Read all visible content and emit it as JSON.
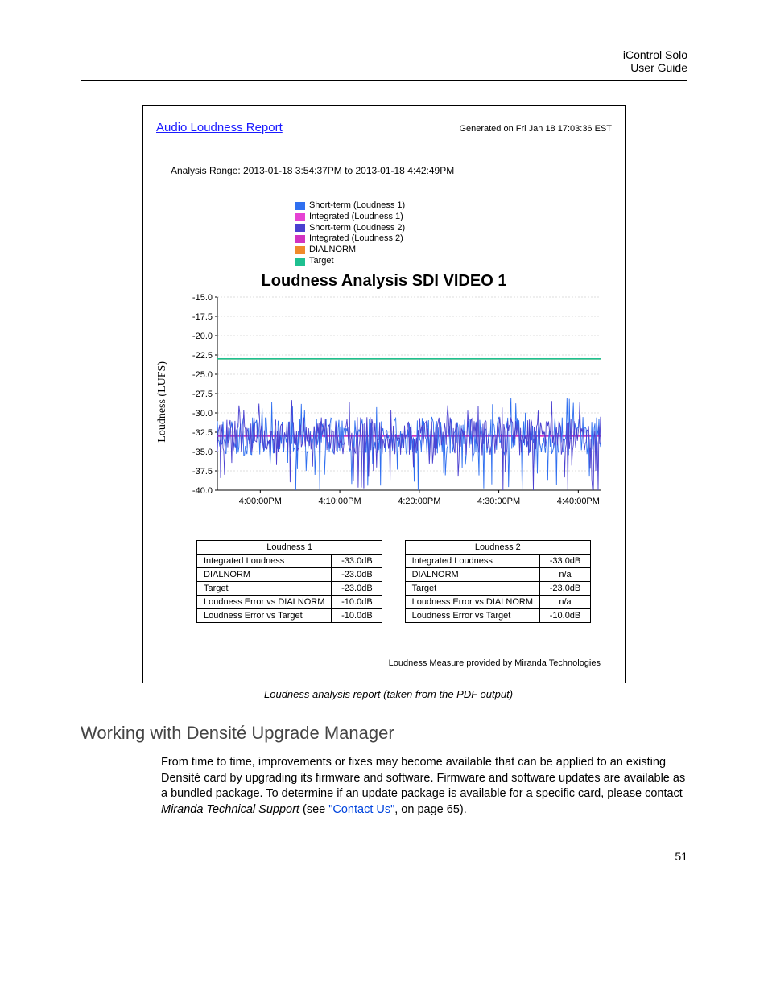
{
  "header": {
    "product": "iControl Solo",
    "doc_type": "User Guide"
  },
  "figure": {
    "report_title": "Audio Loudness Report",
    "generated": "Generated on Fri Jan 18 17:03:36 EST",
    "analysis_range": "Analysis Range: 2013-01-18 3:54:37PM to 2013-01-18 4:42:49PM",
    "legend": [
      {
        "label": "Short-term (Loudness 1)",
        "color": "#2f6ff0"
      },
      {
        "label": "Integrated (Loudness 1)",
        "color": "#e642d3"
      },
      {
        "label": "Short-term (Loudness 2)",
        "color": "#4a40d0"
      },
      {
        "label": "Integrated (Loudness 2)",
        "color": "#d232c0"
      },
      {
        "label": "DIALNORM",
        "color": "#f08a2a"
      },
      {
        "label": "Target",
        "color": "#1fc090"
      }
    ],
    "chart_title": "Loudness Analysis SDI VIDEO 1",
    "ylabel": "Loudness (LUFS)",
    "footer": "Loudness Measure provided by Miranda Technologies"
  },
  "chart_data": {
    "type": "line",
    "ylabel": "Loudness (LUFS)",
    "xlabel": "",
    "ylim": [
      -40.0,
      -15.0
    ],
    "yticks": [
      -15.0,
      -17.5,
      -20.0,
      -22.5,
      -25.0,
      -27.5,
      -30.0,
      -32.5,
      -35.0,
      -37.5,
      -40.0
    ],
    "x_tick_labels": [
      "4:00:00PM",
      "4:10:00PM",
      "4:20:00PM",
      "4:30:00PM",
      "4:40:00PM"
    ],
    "x_range": [
      "3:54:37PM",
      "4:42:49PM"
    ],
    "series": [
      {
        "name": "Short-term (Loudness 1)",
        "color": "#2f6ff0",
        "approx_mean": -33.0,
        "approx_range": [
          -40.0,
          -28.5
        ],
        "style": "noisy"
      },
      {
        "name": "Integrated (Loudness 1)",
        "color": "#e642d3",
        "constant": -33.0
      },
      {
        "name": "Short-term (Loudness 2)",
        "color": "#4a40d0",
        "approx_mean": -33.0,
        "approx_range": [
          -40.0,
          -28.5
        ],
        "style": "noisy"
      },
      {
        "name": "Integrated (Loudness 2)",
        "color": "#d232c0",
        "constant": -33.0
      },
      {
        "name": "DIALNORM",
        "color": "#f08a2a",
        "constant": -23.0
      },
      {
        "name": "Target",
        "color": "#1fc090",
        "constant": -23.0
      }
    ]
  },
  "tables": {
    "t1": {
      "title": "Loudness 1",
      "rows": [
        {
          "label": "Integrated Loudness",
          "value": "-33.0dB"
        },
        {
          "label": "DIALNORM",
          "value": "-23.0dB"
        },
        {
          "label": "Target",
          "value": "-23.0dB"
        },
        {
          "label": "Loudness Error vs DIALNORM",
          "value": "-10.0dB"
        },
        {
          "label": "Loudness Error vs Target",
          "value": "-10.0dB"
        }
      ]
    },
    "t2": {
      "title": "Loudness 2",
      "rows": [
        {
          "label": "Integrated Loudness",
          "value": "-33.0dB"
        },
        {
          "label": "DIALNORM",
          "value": "n/a"
        },
        {
          "label": "Target",
          "value": "-23.0dB"
        },
        {
          "label": "Loudness Error vs DIALNORM",
          "value": "n/a"
        },
        {
          "label": "Loudness Error vs Target",
          "value": "-10.0dB"
        }
      ]
    }
  },
  "caption": "Loudness analysis report (taken from the PDF output)",
  "section": {
    "heading": "Working with Densité Upgrade Manager",
    "para_prefix": "From time to time, improvements or fixes may become available that can be applied to an existing Densité card by upgrading its firmware and software. Firmware and software updates are available as a bundled package. To determine if an update package is available for a specific card, please contact ",
    "italic": "Miranda Technical Support",
    "mid": " (see ",
    "link": "\"Contact Us\"",
    "suffix": ", on page 65)."
  },
  "page_number": "51"
}
